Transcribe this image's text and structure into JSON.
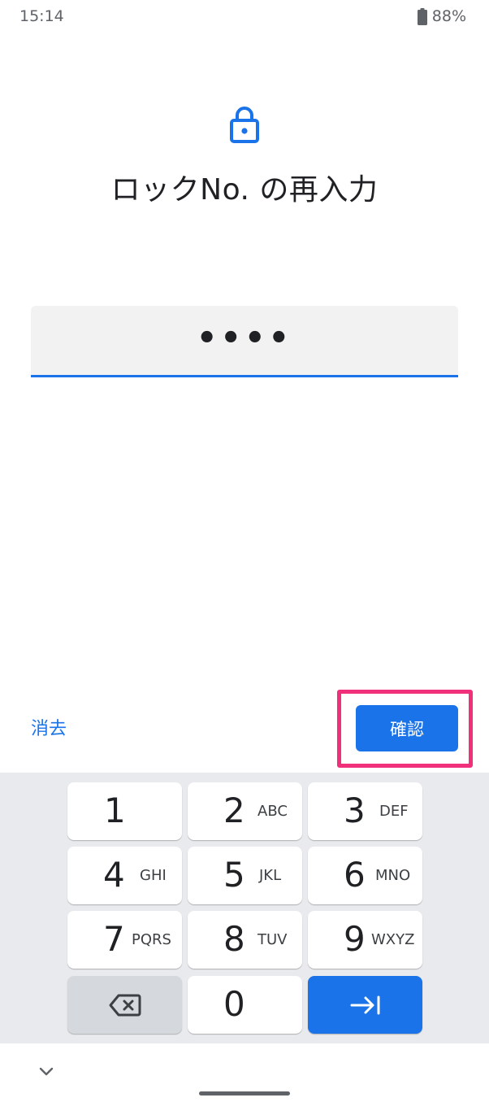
{
  "status_bar": {
    "time": "15:14",
    "battery": "88%",
    "battery_icon": "battery-icon"
  },
  "header": {
    "icon": "lock-icon",
    "title": "ロックNo. の再入力"
  },
  "pin_field": {
    "value": "••••"
  },
  "actions": {
    "clear_label": "消去",
    "confirm_label": "確認"
  },
  "keypad": {
    "keys": [
      {
        "digit": "1",
        "letters": ""
      },
      {
        "digit": "2",
        "letters": "ABC"
      },
      {
        "digit": "3",
        "letters": "DEF"
      },
      {
        "digit": "4",
        "letters": "GHI"
      },
      {
        "digit": "5",
        "letters": "JKL"
      },
      {
        "digit": "6",
        "letters": "MNO"
      },
      {
        "digit": "7",
        "letters": "PQRS"
      },
      {
        "digit": "8",
        "letters": "TUV"
      },
      {
        "digit": "9",
        "letters": "WXYZ"
      },
      {
        "digit": "0",
        "letters": ""
      }
    ],
    "backspace_icon": "backspace-icon",
    "next_icon": "tab-next-icon"
  },
  "colors": {
    "accent": "#1a73e8",
    "highlight": "#f0307a",
    "keyboard_bg": "#e8eaed"
  }
}
